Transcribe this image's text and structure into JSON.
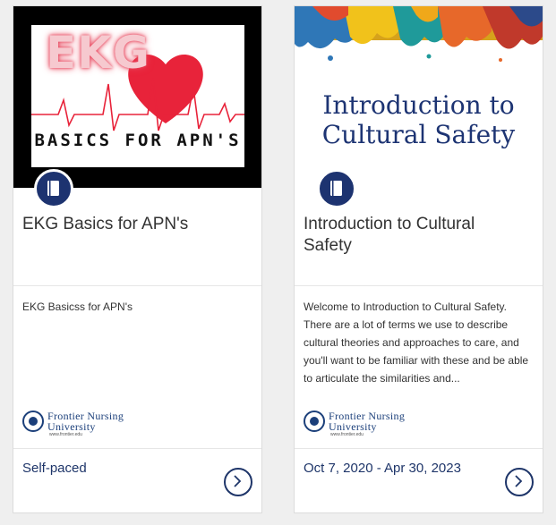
{
  "cards": [
    {
      "banner": {
        "word": "EKG",
        "subtitle": "BASICS FOR APN'S",
        "icon": "ekg-heart-icon"
      },
      "badge_icon": "book-icon",
      "title": "EKG Basics for APN's",
      "description": "EKG Basicss for APN's",
      "logo": {
        "line1": "Frontier Nursing",
        "line2": "University",
        "line3": "www.frontier.edu"
      },
      "footer": "Self-paced",
      "action_icon": "chevron-right-icon"
    },
    {
      "banner": {
        "title": "Introduction to Cultural Safety",
        "icon": "paint-splash-icon"
      },
      "badge_icon": "book-icon",
      "title": "Introduction to Cultural Safety",
      "description": "Welcome to Introduction to Cultural Safety. There are a lot of terms we use to describe cultural theories and approaches to care, and you'll want to be familiar with these and be able to articulate the similarities and...",
      "logo": {
        "line1": "Frontier Nursing",
        "line2": "University",
        "line3": "www.frontier.edu"
      },
      "footer": "Oct 7, 2020 - Apr 30, 2023",
      "action_icon": "chevron-right-icon"
    }
  ],
  "colors": {
    "navy": "#1d3370",
    "heart_red": "#e8233a",
    "page_bg": "#efefef"
  }
}
